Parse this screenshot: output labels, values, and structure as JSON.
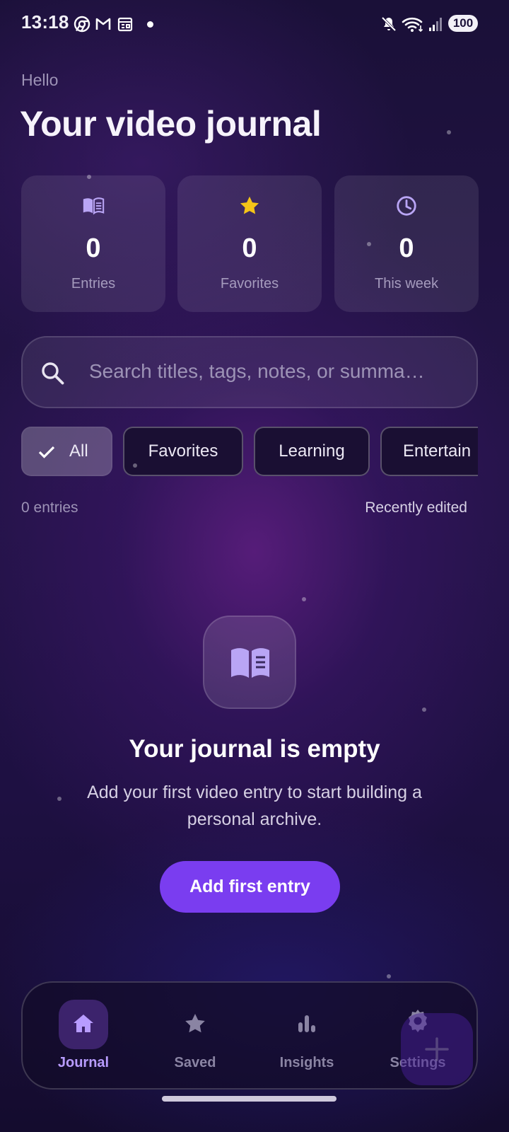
{
  "status_bar": {
    "time": "13:18",
    "battery": "100",
    "icons": [
      "chrome-icon",
      "gmail-icon",
      "calendar-icon",
      "mute-icon",
      "wifi-icon",
      "signal-icon",
      "battery-icon"
    ]
  },
  "header": {
    "greeting": "Hello",
    "title": "Your video journal"
  },
  "stats": [
    {
      "icon": "book-icon",
      "value": "0",
      "label": "Entries",
      "color": "#b9a5f5"
    },
    {
      "icon": "star-icon",
      "value": "0",
      "label": "Favorites",
      "color": "#f5c518"
    },
    {
      "icon": "clock-icon",
      "value": "0",
      "label": "This week",
      "color": "#b9a5f5"
    }
  ],
  "search": {
    "placeholder": "Search titles, tags, notes, or summa…",
    "value": ""
  },
  "filters": {
    "chips": [
      {
        "label": "All",
        "selected": true
      },
      {
        "label": "Favorites",
        "selected": false
      },
      {
        "label": "Learning",
        "selected": false
      },
      {
        "label": "Entertain",
        "selected": false
      }
    ]
  },
  "list_meta": {
    "count": "0 entries",
    "sort": "Recently edited"
  },
  "empty_state": {
    "icon": "book-icon",
    "title": "Your journal is empty",
    "description": "Add your first video entry to start building a personal archive.",
    "button_label": "Add first entry"
  },
  "bottom_nav": {
    "items": [
      {
        "icon": "home-icon",
        "label": "Journal",
        "active": true
      },
      {
        "icon": "star-icon",
        "label": "Saved",
        "active": false
      },
      {
        "icon": "bar-chart-icon",
        "label": "Insights",
        "active": false
      },
      {
        "icon": "gear-icon",
        "label": "Settings",
        "active": false
      }
    ]
  },
  "fab": {
    "icon": "plus-icon"
  },
  "colors": {
    "accent": "#7a3df0",
    "nav_active": "#b89cff",
    "star": "#f5c518"
  }
}
